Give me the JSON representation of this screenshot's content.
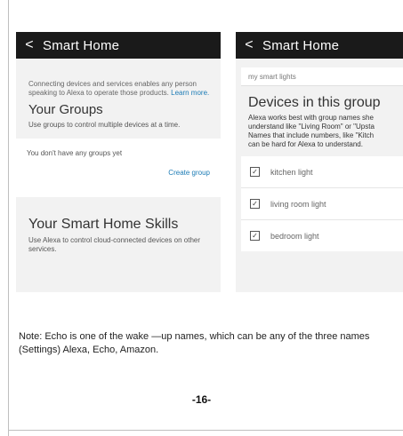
{
  "screen_left": {
    "title": "Smart Home",
    "back_glyph": "<",
    "intro_text": "Connecting devices and services enables any person speaking to Alexa to operate those products.",
    "learn_more": "Learn more.",
    "groups_heading": "Your Groups",
    "groups_desc": "Use groups to control multiple devices at a time.",
    "no_groups_text": "You don't have any groups yet",
    "create_group": "Create group",
    "skills_heading": "Your Smart Home Skills",
    "skills_desc": "Use Alexa to control cloud-connected devices on other services."
  },
  "screen_right": {
    "title": "Smart Home",
    "back_glyph": "<",
    "group_name_value": "my smart lights",
    "devices_heading": "Devices in this group",
    "devices_desc_lines": [
      "Alexa works best with group names she",
      "understand like \"Living Room\" or \"Upsta",
      "Names that include numbers, like \"Kitch",
      "can be hard for Alexa to understand."
    ],
    "devices": [
      {
        "label": "kitchen light",
        "checked": true
      },
      {
        "label": "living room light",
        "checked": true
      },
      {
        "label": "bedroom light",
        "checked": true
      }
    ],
    "check_glyph": "✓"
  },
  "note": "Note: Echo is one of the wake —up names, which can be any of the three names (Settings) Alexa, Echo, Amazon.",
  "page_number": "-16-"
}
